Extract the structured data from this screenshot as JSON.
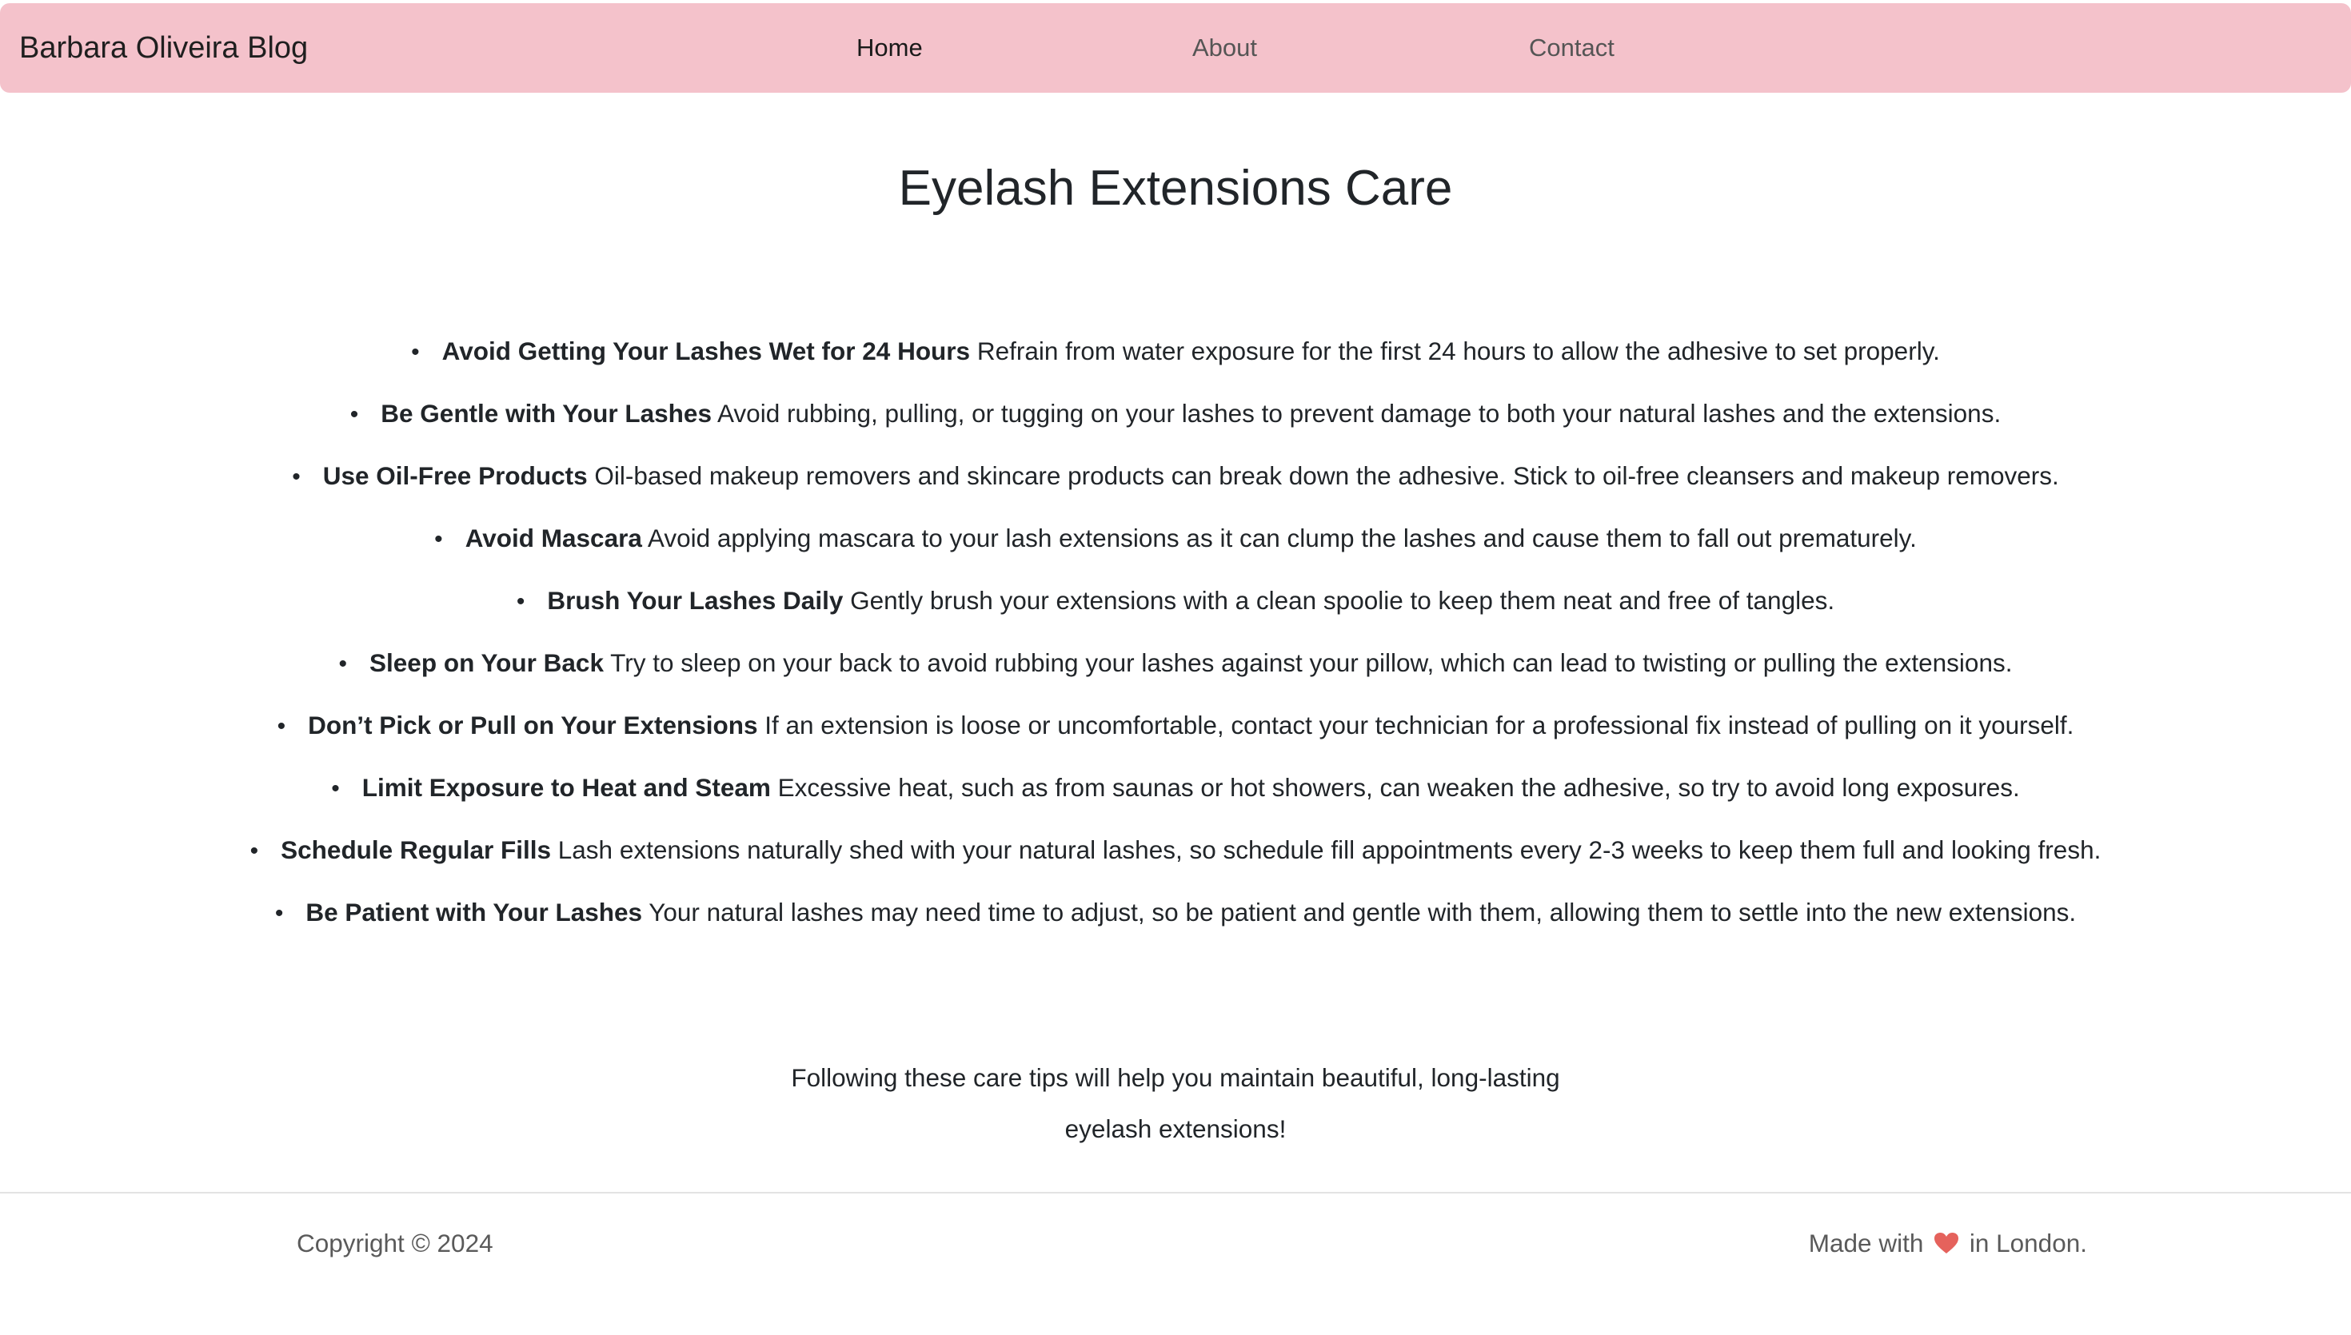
{
  "navbar": {
    "brand": "Barbara Oliveira Blog",
    "links": [
      {
        "label": "Home",
        "active": true
      },
      {
        "label": "About",
        "active": false
      },
      {
        "label": "Contact",
        "active": false
      }
    ],
    "background_color": "#f4c2cb"
  },
  "page": {
    "title": "Eyelash Extensions Care"
  },
  "tips": [
    {
      "title": "Avoid Getting Your Lashes Wet for 24 Hours",
      "text": "Refrain from water exposure for the first 24 hours to allow the adhesive to set properly."
    },
    {
      "title": "Be Gentle with Your Lashes",
      "text": "Avoid rubbing, pulling, or tugging on your lashes to prevent damage to both your natural lashes and the extensions."
    },
    {
      "title": "Use Oil-Free Products",
      "text": "Oil-based makeup removers and skincare products can break down the adhesive. Stick to oil-free cleansers and makeup removers."
    },
    {
      "title": "Avoid Mascara",
      "text": "Avoid applying mascara to your lash extensions as it can clump the lashes and cause them to fall out prematurely."
    },
    {
      "title": "Brush Your Lashes Daily",
      "text": "Gently brush your extensions with a clean spoolie to keep them neat and free of tangles."
    },
    {
      "title": "Sleep on Your Back",
      "text": "Try to sleep on your back to avoid rubbing your lashes against your pillow, which can lead to twisting or pulling the extensions."
    },
    {
      "title": "Don’t Pick or Pull on Your Extensions",
      "text": "If an extension is loose or uncomfortable, contact your technician for a professional fix instead of pulling on it yourself."
    },
    {
      "title": "Limit Exposure to Heat and Steam",
      "text": "Excessive heat, such as from saunas or hot showers, can weaken the adhesive, so try to avoid long exposures."
    },
    {
      "title": "Schedule Regular Fills",
      "text": "Lash extensions naturally shed with your natural lashes, so schedule fill appointments every 2-3 weeks to keep them full and looking fresh."
    },
    {
      "title": "Be Patient with Your Lashes",
      "text": "Your natural lashes may need time to adjust, so be patient and gentle with them, allowing them to settle into the new extensions."
    }
  ],
  "closing": {
    "line1": "Following these care tips will help you maintain beautiful, long-lasting",
    "line2": "eyelash extensions!"
  },
  "footer": {
    "copyright": "Copyright © 2024",
    "made_with_prefix": "Made with",
    "made_with_icon": "heart-icon",
    "made_with_suffix": "in London.",
    "heart_color": "#e5625c"
  }
}
